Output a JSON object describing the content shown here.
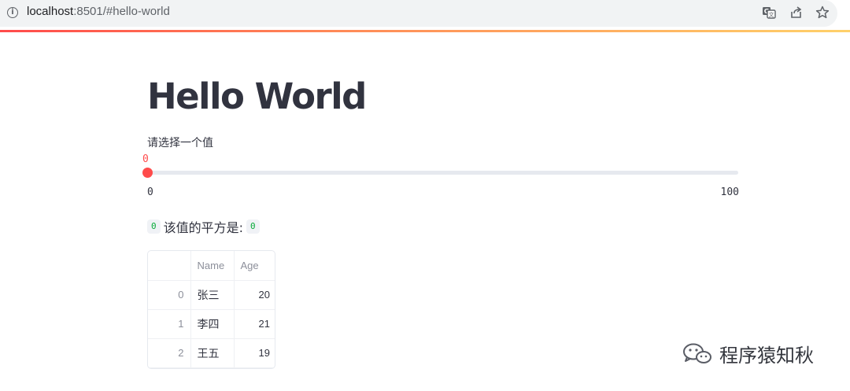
{
  "browser": {
    "url_host": "localhost",
    "url_rest": ":8501/#hello-world",
    "info_icon": "info-icon",
    "icons": [
      "translate-icon",
      "share-icon",
      "bookmark-star-icon"
    ]
  },
  "page": {
    "title": "Hello World",
    "slider": {
      "label": "请选择一个值",
      "value": "0",
      "min": "0",
      "max": "100",
      "fraction": 0.0,
      "accent_color": "#ff4b4b"
    },
    "result": {
      "input_value": "0",
      "text": "该值的平方是:",
      "output_value": "0",
      "code_color": "#09ab3b"
    },
    "table": {
      "columns": [
        "",
        "Name",
        "Age"
      ],
      "rows": [
        {
          "index": "0",
          "name": "张三",
          "age": "20"
        },
        {
          "index": "1",
          "name": "李四",
          "age": "21"
        },
        {
          "index": "2",
          "name": "王五",
          "age": "19"
        }
      ]
    }
  },
  "watermark": {
    "icon": "wechat-icon",
    "text": "程序猿知秋"
  }
}
